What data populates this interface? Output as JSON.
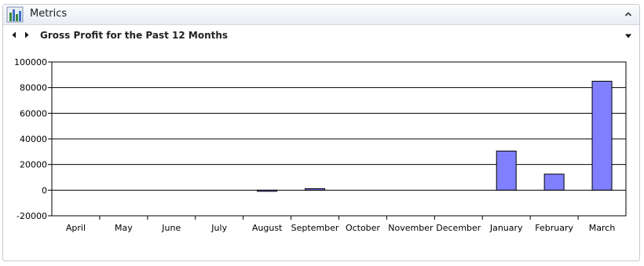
{
  "panel": {
    "title": "Metrics",
    "icon": "bar-chart-icon",
    "collapse_icon": "chevron-up-icon"
  },
  "subheader": {
    "prev_icon": "triangle-left-icon",
    "next_icon": "triangle-right-icon",
    "menu_icon": "triangle-down-icon"
  },
  "colors": {
    "bar_fill": "#8080ff",
    "bar_stroke": "#000000"
  },
  "chart_data": {
    "type": "bar",
    "title": "Gross Profit for the Past 12 Months",
    "xlabel": "",
    "ylabel": "",
    "categories": [
      "April",
      "May",
      "June",
      "July",
      "August",
      "September",
      "October",
      "November",
      "December",
      "January",
      "February",
      "March"
    ],
    "values": [
      0,
      0,
      0,
      0,
      -500,
      1200,
      0,
      0,
      0,
      30500,
      12500,
      85000
    ],
    "ylim": [
      -20000,
      100000
    ],
    "yticks": [
      "-20000",
      "0",
      "20000",
      "40000",
      "60000",
      "80000",
      "100000"
    ],
    "grid": true,
    "legend": "none"
  }
}
